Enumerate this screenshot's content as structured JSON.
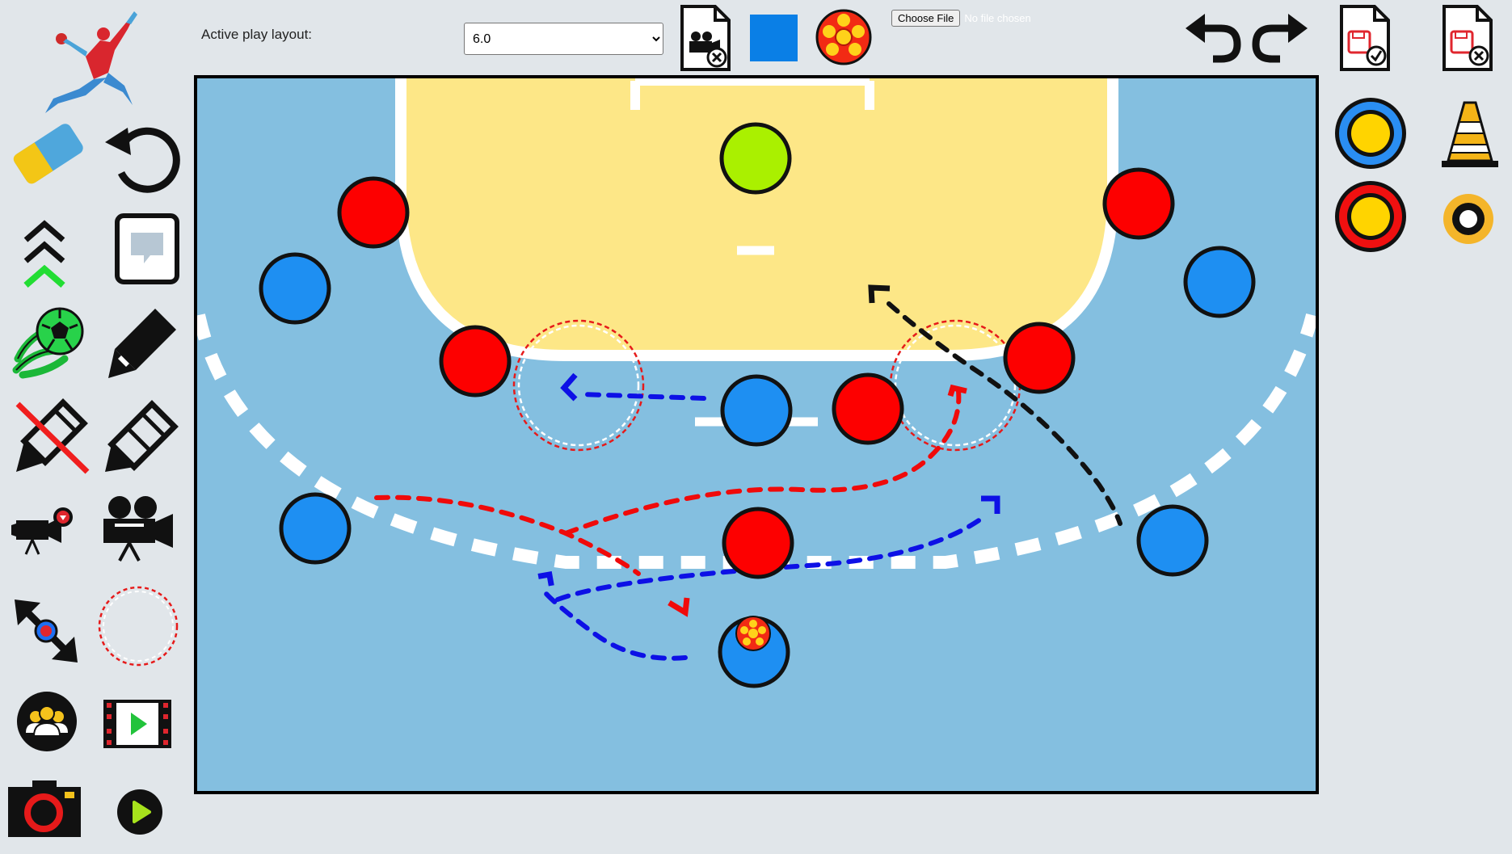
{
  "toolbar": {
    "layout_label": "Active play layout:",
    "layout_selected": "6.0",
    "layout_options": [
      "6.0"
    ],
    "file_button_label": "Choose File",
    "file_status": "No file chosen",
    "selected_color": "#0a7fe6"
  },
  "sidebar_left": {
    "tools": [
      {
        "name": "eraser-tool",
        "icon": "eraser-icon"
      },
      {
        "name": "reset-tool",
        "icon": "rotate-icon"
      },
      {
        "name": "layer-up-tool",
        "icon": "chevrons-up-icon"
      },
      {
        "name": "comment-tool",
        "icon": "speech-bubble-icon"
      },
      {
        "name": "ball-move-tool",
        "icon": "ball-trail-icon"
      },
      {
        "name": "pen-tool",
        "icon": "pen-icon"
      },
      {
        "name": "pen-disable-tool",
        "icon": "pen-crossed-icon"
      },
      {
        "name": "pencil-tool",
        "icon": "pencil-icon"
      },
      {
        "name": "record-frame-tool",
        "icon": "camera-record-icon"
      },
      {
        "name": "video-tool",
        "icon": "movie-camera-icon"
      },
      {
        "name": "resize-tool",
        "icon": "resize-arrows-icon"
      },
      {
        "name": "zone-circle-tool",
        "icon": "dashed-circle-icon"
      },
      {
        "name": "team-tool",
        "icon": "team-icon"
      },
      {
        "name": "film-play-tool",
        "icon": "film-play-icon"
      },
      {
        "name": "screenshot-tool",
        "icon": "photo-camera-icon"
      },
      {
        "name": "play-tool",
        "icon": "play-icon"
      }
    ]
  },
  "sidebar_right": {
    "tools": [
      {
        "name": "blue-player-token",
        "icon": "blue-ring-icon"
      },
      {
        "name": "cone-token",
        "icon": "cone-icon"
      },
      {
        "name": "red-player-token",
        "icon": "red-ring-icon"
      },
      {
        "name": "marker-token",
        "icon": "orange-ring-icon"
      }
    ]
  },
  "colors": {
    "court": "#84bfe0",
    "goal_area": "#fde787",
    "attack_team": "#1e8ff2",
    "defense_team": "#fd0000",
    "goalkeeper": "#aaf000",
    "path_blue": "#0d10e6",
    "path_red": "#f00a0a",
    "path_black": "#000000"
  }
}
